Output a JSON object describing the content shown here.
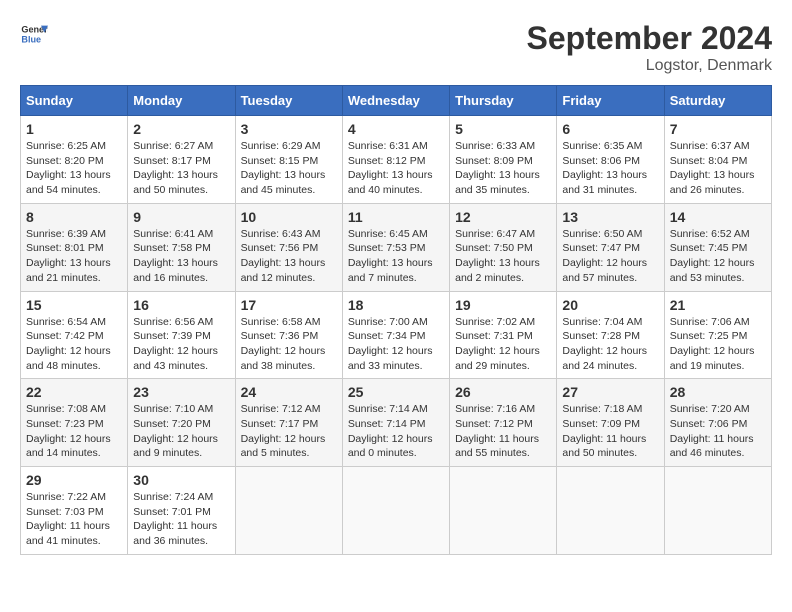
{
  "header": {
    "logo_line1": "General",
    "logo_line2": "Blue",
    "month": "September 2024",
    "location": "Logstor, Denmark"
  },
  "weekdays": [
    "Sunday",
    "Monday",
    "Tuesday",
    "Wednesday",
    "Thursday",
    "Friday",
    "Saturday"
  ],
  "days": [
    {
      "day": "",
      "info": ""
    },
    {
      "day": "",
      "info": ""
    },
    {
      "day": "",
      "info": ""
    },
    {
      "day": "",
      "info": ""
    },
    {
      "day": "",
      "info": ""
    },
    {
      "day": "",
      "info": ""
    },
    {
      "day": "1",
      "info": "Sunrise: 6:25 AM\nSunset: 8:20 PM\nDaylight: 13 hours\nand 54 minutes."
    },
    {
      "day": "2",
      "info": "Sunrise: 6:27 AM\nSunset: 8:17 PM\nDaylight: 13 hours\nand 50 minutes."
    },
    {
      "day": "3",
      "info": "Sunrise: 6:29 AM\nSunset: 8:15 PM\nDaylight: 13 hours\nand 45 minutes."
    },
    {
      "day": "4",
      "info": "Sunrise: 6:31 AM\nSunset: 8:12 PM\nDaylight: 13 hours\nand 40 minutes."
    },
    {
      "day": "5",
      "info": "Sunrise: 6:33 AM\nSunset: 8:09 PM\nDaylight: 13 hours\nand 35 minutes."
    },
    {
      "day": "6",
      "info": "Sunrise: 6:35 AM\nSunset: 8:06 PM\nDaylight: 13 hours\nand 31 minutes."
    },
    {
      "day": "7",
      "info": "Sunrise: 6:37 AM\nSunset: 8:04 PM\nDaylight: 13 hours\nand 26 minutes."
    },
    {
      "day": "8",
      "info": "Sunrise: 6:39 AM\nSunset: 8:01 PM\nDaylight: 13 hours\nand 21 minutes."
    },
    {
      "day": "9",
      "info": "Sunrise: 6:41 AM\nSunset: 7:58 PM\nDaylight: 13 hours\nand 16 minutes."
    },
    {
      "day": "10",
      "info": "Sunrise: 6:43 AM\nSunset: 7:56 PM\nDaylight: 13 hours\nand 12 minutes."
    },
    {
      "day": "11",
      "info": "Sunrise: 6:45 AM\nSunset: 7:53 PM\nDaylight: 13 hours\nand 7 minutes."
    },
    {
      "day": "12",
      "info": "Sunrise: 6:47 AM\nSunset: 7:50 PM\nDaylight: 13 hours\nand 2 minutes."
    },
    {
      "day": "13",
      "info": "Sunrise: 6:50 AM\nSunset: 7:47 PM\nDaylight: 12 hours\nand 57 minutes."
    },
    {
      "day": "14",
      "info": "Sunrise: 6:52 AM\nSunset: 7:45 PM\nDaylight: 12 hours\nand 53 minutes."
    },
    {
      "day": "15",
      "info": "Sunrise: 6:54 AM\nSunset: 7:42 PM\nDaylight: 12 hours\nand 48 minutes."
    },
    {
      "day": "16",
      "info": "Sunrise: 6:56 AM\nSunset: 7:39 PM\nDaylight: 12 hours\nand 43 minutes."
    },
    {
      "day": "17",
      "info": "Sunrise: 6:58 AM\nSunset: 7:36 PM\nDaylight: 12 hours\nand 38 minutes."
    },
    {
      "day": "18",
      "info": "Sunrise: 7:00 AM\nSunset: 7:34 PM\nDaylight: 12 hours\nand 33 minutes."
    },
    {
      "day": "19",
      "info": "Sunrise: 7:02 AM\nSunset: 7:31 PM\nDaylight: 12 hours\nand 29 minutes."
    },
    {
      "day": "20",
      "info": "Sunrise: 7:04 AM\nSunset: 7:28 PM\nDaylight: 12 hours\nand 24 minutes."
    },
    {
      "day": "21",
      "info": "Sunrise: 7:06 AM\nSunset: 7:25 PM\nDaylight: 12 hours\nand 19 minutes."
    },
    {
      "day": "22",
      "info": "Sunrise: 7:08 AM\nSunset: 7:23 PM\nDaylight: 12 hours\nand 14 minutes."
    },
    {
      "day": "23",
      "info": "Sunrise: 7:10 AM\nSunset: 7:20 PM\nDaylight: 12 hours\nand 9 minutes."
    },
    {
      "day": "24",
      "info": "Sunrise: 7:12 AM\nSunset: 7:17 PM\nDaylight: 12 hours\nand 5 minutes."
    },
    {
      "day": "25",
      "info": "Sunrise: 7:14 AM\nSunset: 7:14 PM\nDaylight: 12 hours\nand 0 minutes."
    },
    {
      "day": "26",
      "info": "Sunrise: 7:16 AM\nSunset: 7:12 PM\nDaylight: 11 hours\nand 55 minutes."
    },
    {
      "day": "27",
      "info": "Sunrise: 7:18 AM\nSunset: 7:09 PM\nDaylight: 11 hours\nand 50 minutes."
    },
    {
      "day": "28",
      "info": "Sunrise: 7:20 AM\nSunset: 7:06 PM\nDaylight: 11 hours\nand 46 minutes."
    },
    {
      "day": "29",
      "info": "Sunrise: 7:22 AM\nSunset: 7:03 PM\nDaylight: 11 hours\nand 41 minutes."
    },
    {
      "day": "30",
      "info": "Sunrise: 7:24 AM\nSunset: 7:01 PM\nDaylight: 11 hours\nand 36 minutes."
    },
    {
      "day": "",
      "info": ""
    },
    {
      "day": "",
      "info": ""
    },
    {
      "day": "",
      "info": ""
    },
    {
      "day": "",
      "info": ""
    },
    {
      "day": "",
      "info": ""
    }
  ]
}
